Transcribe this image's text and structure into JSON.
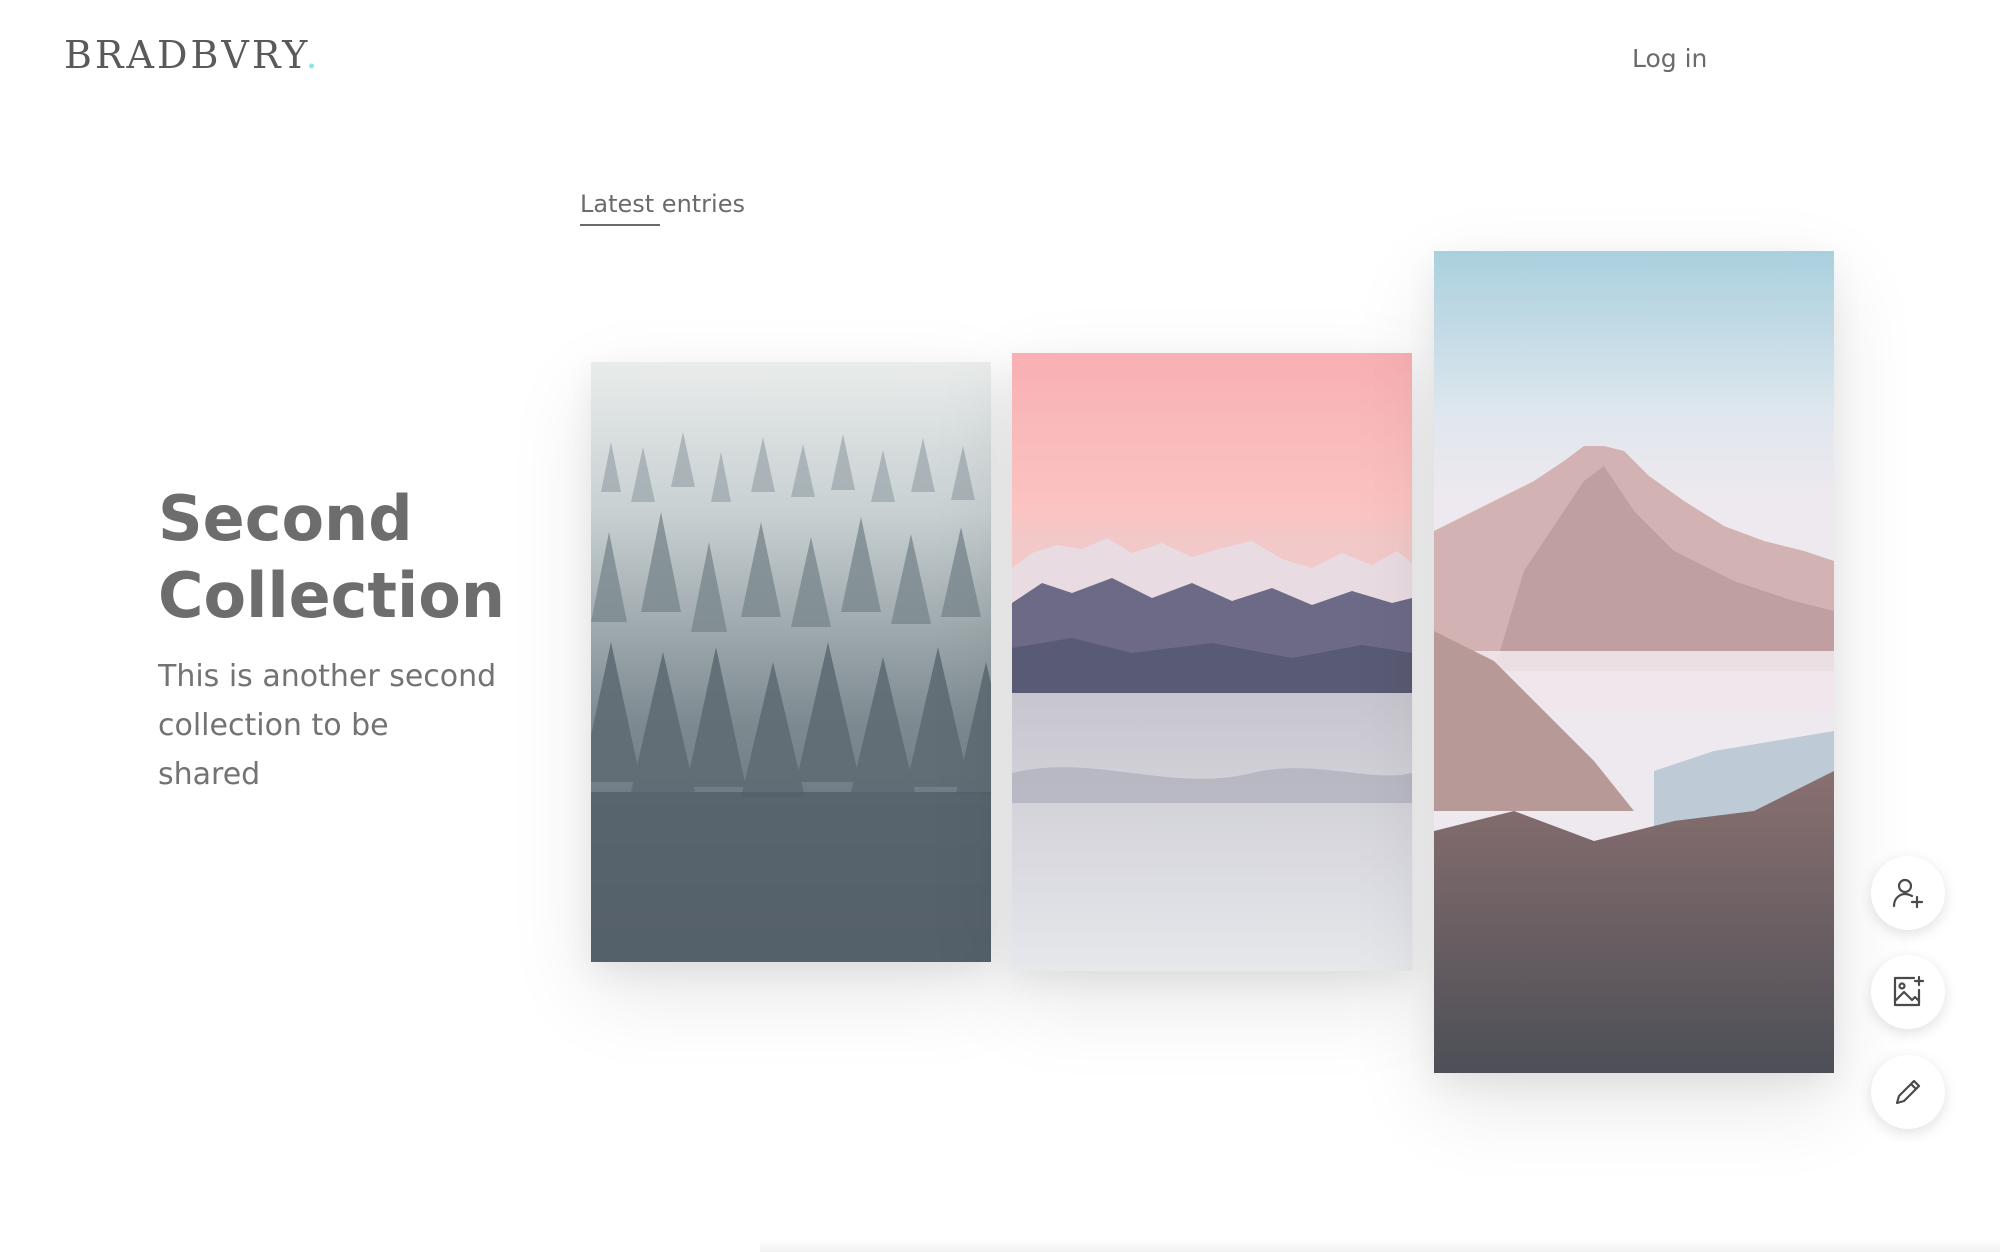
{
  "header": {
    "logo_text": "BRADBVRY",
    "logo_dot": ".",
    "login_label": "Log in"
  },
  "section": {
    "tab_label": "Latest entries"
  },
  "collection": {
    "title": "Second Collection",
    "description": "This is another second collection to be shared"
  },
  "photos": [
    {
      "subject": "misty pine forest"
    },
    {
      "subject": "snowy mountain range at pink dusk"
    },
    {
      "subject": "rocky mountain peak above fog"
    }
  ],
  "actions": [
    {
      "icon": "add-user-icon"
    },
    {
      "icon": "add-image-icon"
    },
    {
      "icon": "pencil-icon"
    }
  ],
  "colors": {
    "logo_accent": "#8fe3ea",
    "text": "#6d6d6d",
    "background": "#ffffff"
  }
}
